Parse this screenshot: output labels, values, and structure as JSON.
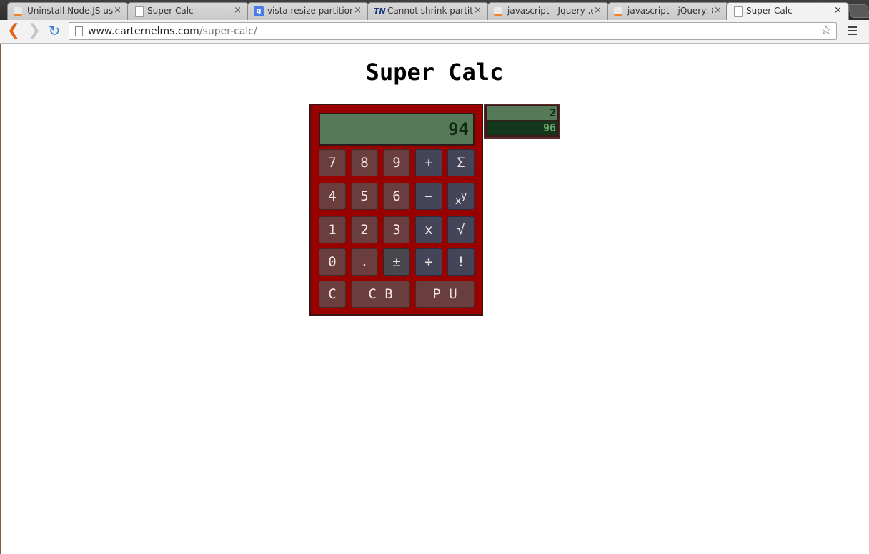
{
  "browser": {
    "tabs": [
      {
        "label": "Uninstall Node.JS usi",
        "icon": "stackoverflow-icon"
      },
      {
        "label": "Super Calc",
        "icon": "page-icon"
      },
      {
        "label": "vista resize partition",
        "icon": "google-icon"
      },
      {
        "label": "Cannot shrink partiti",
        "icon": "tn-icon"
      },
      {
        "label": "javascript - Jquery .e",
        "icon": "stackoverflow-icon"
      },
      {
        "label": "javascript - jQuery: G",
        "icon": "stackoverflow-icon"
      },
      {
        "label": "Super Calc",
        "icon": "page-icon",
        "active": true
      }
    ],
    "close_glyph": "×",
    "url_host": "www.carternelms.com",
    "url_path": "/super-calc/"
  },
  "page": {
    "title": "Super Calc"
  },
  "calculator": {
    "display": "94",
    "keys": [
      [
        "7",
        "8",
        "9",
        "+",
        "Σ"
      ],
      [
        "4",
        "5",
        "6",
        "−",
        "x^y"
      ],
      [
        "1",
        "2",
        "3",
        "x",
        "√"
      ],
      [
        "0",
        ".",
        "±",
        "÷",
        "!"
      ],
      [
        "C",
        "C B",
        "P U"
      ]
    ],
    "history": [
      "2",
      "96"
    ]
  },
  "colors": {
    "calc_body": "#990000",
    "display_bg": "#567a58",
    "number_key": "#6a3e3e",
    "operator_key": "#45455a"
  }
}
